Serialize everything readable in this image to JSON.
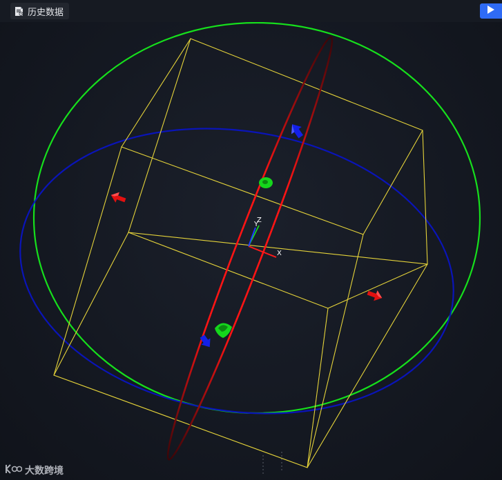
{
  "toolbar": {
    "history_label": "历史数据",
    "history_icon": "document-icon",
    "play_icon": "play-icon",
    "accent_color": "#2f6bf5"
  },
  "gizmo": {
    "x_label": "X",
    "y_label": "Y",
    "z_label": "Z"
  },
  "watermark": {
    "text": "大数跨境",
    "logo_icon": "brand-logo-icon"
  },
  "colors": {
    "background": "#141821",
    "bounding_box": "#e6d43a",
    "ring_x": "#ff1a1a",
    "ring_y": "#16e01c",
    "ring_z": "#0a14b8",
    "arrow_x": "#e21010",
    "arrow_y": "#15d61c",
    "arrow_z": "#1320e8"
  }
}
